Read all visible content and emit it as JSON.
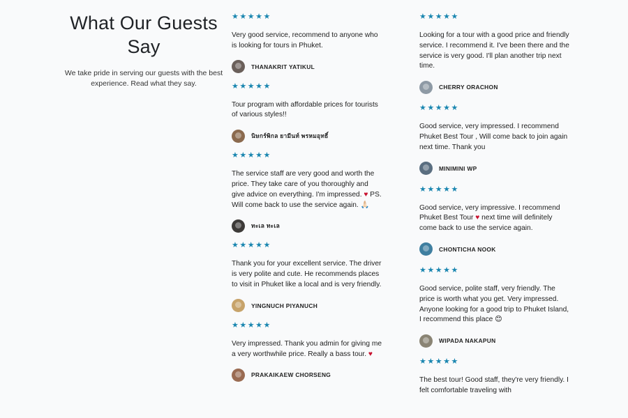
{
  "intro": {
    "title_line1": "What Our Guests",
    "title_line2": "Say",
    "subtitle": "We take pride in serving our guests with the best experience. Read what they say."
  },
  "stars": "★★★★★",
  "rating": 5,
  "columns": [
    [
      {
        "text": "Very good service, recommend to anyone who is looking for tours in Phuket.",
        "author": "THANAKRIT YATIKUL",
        "avatar_color": "#6a5f5a"
      },
      {
        "text": "Tour program with affordable prices for tourists of various styles!!",
        "author": "นิษกร์พิกล ยามีนท์ พรหมอุทธิ์",
        "avatar_color": "#8b6a4e"
      },
      {
        "text_before": "The service staff are very good and worth the price. They take care of you thoroughly and give advice on everything. I'm impressed. ",
        "heart": "♥",
        "text_after": " PS. Will come back to use the service again. 🙏🏻",
        "author": "ทะเล ทะเล",
        "avatar_color": "#3d3a38"
      },
      {
        "text": "Thank you for your excellent service. The driver is very polite and cute. He recommends places to visit in Phuket like a local and is very friendly.",
        "author": "YINGNUCH PIYANUCH",
        "avatar_color": "#c7a36a"
      },
      {
        "text_before": "Very impressed. Thank you admin for giving me a very worthwhile price. Really a bass tour. ",
        "heart": "♥",
        "text_after": "",
        "author": "PRAKAIKAEW CHORSENG",
        "avatar_color": "#9a6b52"
      }
    ],
    [
      {
        "text": "Looking for a tour with a good price and friendly service. I recommend it. I've been there and the service is very good. I'll plan another trip next time.",
        "author": "CHERRY ORACHON",
        "avatar_color": "#8e9aa5"
      },
      {
        "text": "Good service, very impressed. I recommend Phuket Best Tour , Will come back to join again next time. Thank you",
        "author": "MINIMINI WP",
        "avatar_color": "#5a6e80"
      },
      {
        "text_before": "Good service, very impressive. I recommend Phuket Best Tour ",
        "heart": "♥",
        "text_after": " next time will definitely come back to use the service again.",
        "author": "CHONTICHA NOOK",
        "avatar_color": "#3f7fa0"
      },
      {
        "text": "Good service, polite staff, very friendly. The price is worth what you get. Very impressed. Anyone looking for a good trip to Phuket Island, I recommend this place 😊",
        "author": "WIPADA NAKAPUN",
        "avatar_color": "#8a8474"
      },
      {
        "text": "The best tour! Good staff, they're very friendly. I felt comfortable traveling with",
        "author": "",
        "avatar_color": "#777777"
      }
    ]
  ]
}
